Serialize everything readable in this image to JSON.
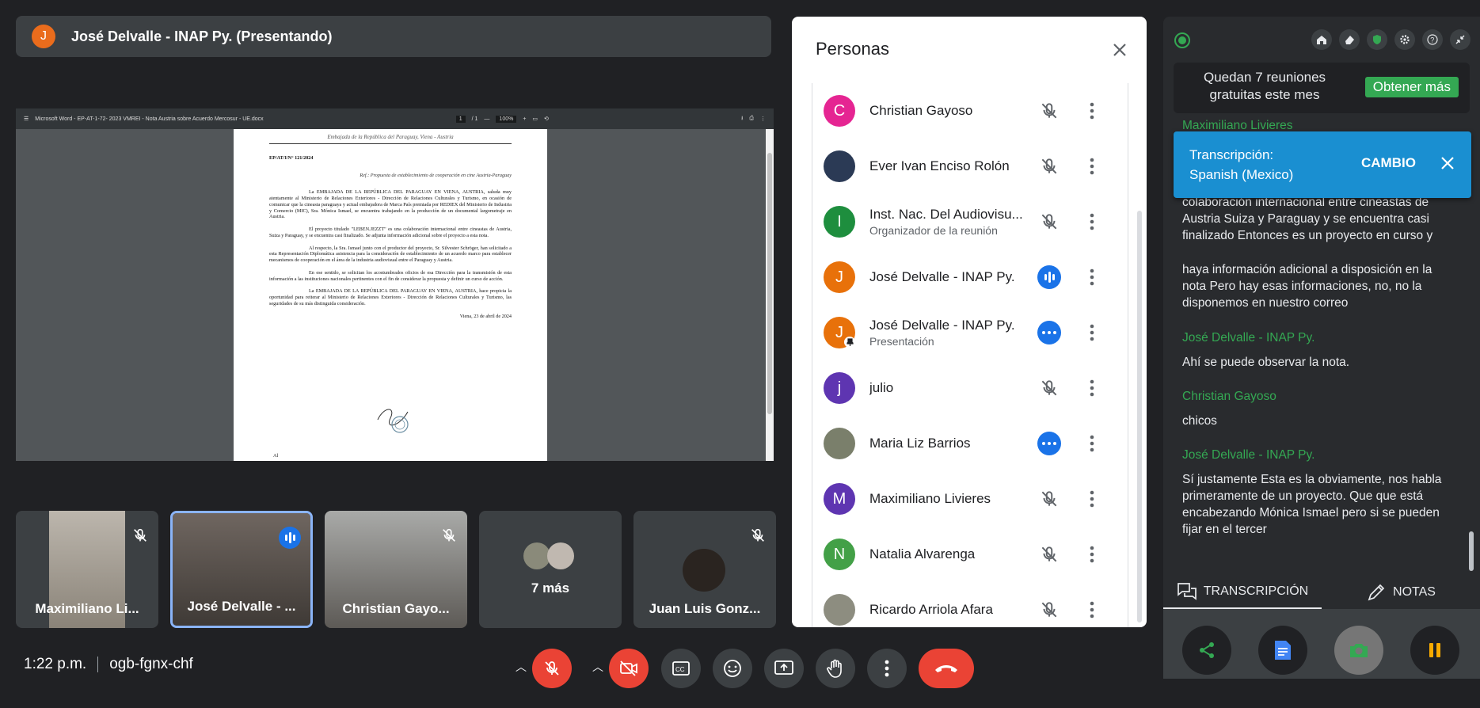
{
  "presenter": {
    "avatar_letter": "J",
    "title": "José Delvalle - INAP Py. (Presentando)"
  },
  "shared_doc": {
    "filename": "Microsoft Word - EP-AT-1-72- 2023 VMREI - Nota Austria sobre Acuerdo Mercosur - UE.docx",
    "page": "1",
    "page_total": "/ 1",
    "zoom": "100%",
    "header": "Embajada de la República del Paraguay, Viena - Austria",
    "ref_no": "EP/AT/I/N° 121/2024",
    "ref": "Ref.: Propuesta de establecimiento de cooperación en cine Austria-Paraguay",
    "paragraphs": [
      "La EMBAJADA DE LA REPÚBLICA DEL PARAGUAY EN VIENA, AUSTRIA, saluda muy atentamente al Ministerio de Relaciones Exteriores - Dirección de Relaciones Culturales y Turismo, en ocasión de comunicar que la cineasta paraguaya y actual embajadora de Marca País premiada por REDIEX del Ministerio de Industria y Comercio (MIC), Sra. Mónica Ismael, se encuentra trabajando en la producción de un documental largometraje en Austria.",
      "El proyecto titulado \"LEBEN.JEZZT\" es una colaboración internacional entre cineastas de Austria, Suiza y Paraguay, y se encuentra casi finalizado. Se adjunta información adicional sobre el proyecto a esta nota.",
      "Al respecto, la Sra. Ismael junto con el productor del proyecto, Sr. Silvester Schröger, han solicitado a esta Representación Diplomática asistencia para la consideración de establecimiento de un acuerdo marco para establecer mecanismos de cooperación en el área de la industria audiovisual entre el Paraguay y Austria.",
      "En ese sentido, se solicitan los acostumbrados oficios de esa Dirección para la transmisión de esta información a las instituciones nacionales pertinentes con el fin de considerar la propuesta y definir un curso de acción.",
      "La EMBAJADA DE LA REPÚBLICA DEL PARAGUAY EN VIENA, AUSTRIA, hace propicia la oportunidad para reiterar al Ministerio de Relaciones Exteriores - Dirección de Relaciones Culturales y Turismo, las seguridades de su más distinguida consideración."
    ],
    "date": "Viena, 23 de abril de 2024",
    "footer": "Al"
  },
  "tiles": [
    {
      "name": "Maximiliano Li...",
      "muted": true
    },
    {
      "name": "José Delvalle - ...",
      "speaking": true
    },
    {
      "name": "Christian Gayo...",
      "muted": true
    },
    {
      "name": "7 más"
    },
    {
      "name": "Juan Luis Gonz...",
      "muted": true
    }
  ],
  "meeting": {
    "time": "1:22 p.m.",
    "code": "ogb-fgnx-chf"
  },
  "people_panel": {
    "title": "Personas",
    "people": [
      {
        "initial": "C",
        "color": "#e52592",
        "name": "Christian Gayoso",
        "sub": "",
        "state": "muted"
      },
      {
        "initial": "",
        "color": "#2b3a55",
        "name": "Ever Ivan Enciso Rolón",
        "sub": "",
        "state": "muted"
      },
      {
        "initial": "I",
        "color": "#1e8e3e",
        "name": "Inst. Nac. Del Audiovisu...",
        "sub": "Organizador de la reunión",
        "state": "muted"
      },
      {
        "initial": "J",
        "color": "#e8710a",
        "name": "José Delvalle - INAP Py.",
        "sub": "",
        "state": "speaking"
      },
      {
        "initial": "J",
        "color": "#e8710a",
        "name": "José Delvalle - INAP Py.",
        "sub": "Presentación",
        "state": "idle"
      },
      {
        "initial": "j",
        "color": "#5e35b1",
        "name": "julio",
        "sub": "",
        "state": "muted"
      },
      {
        "initial": "",
        "color": "#7a7f6b",
        "name": "Maria Liz Barrios",
        "sub": "",
        "state": "idle"
      },
      {
        "initial": "M",
        "color": "#5e35b1",
        "name": "Maximiliano Livieres",
        "sub": "",
        "state": "muted"
      },
      {
        "initial": "N",
        "color": "#43a047",
        "name": "Natalia Alvarenga",
        "sub": "",
        "state": "muted"
      },
      {
        "initial": "",
        "color": "#8d8d80",
        "name": "Ricardo Arriola Afara",
        "sub": "",
        "state": "muted"
      }
    ]
  },
  "transcript": {
    "promo_text": "Quedan 7 reuniones gratuitas este mes",
    "promo_button": "Obtener más",
    "banner_line1": "Transcripción:",
    "banner_line2": "Spanish (Mexico)",
    "banner_change": "CAMBIO",
    "entries": [
      {
        "speaker": "Maximiliano Livieres",
        "text": ""
      },
      {
        "speaker": "",
        "text": "colaboración internacional entre cineastas de Austria Suiza y Paraguay y se encuentra casi finalizado Entonces es un proyecto en curso y"
      },
      {
        "speaker": "",
        "text": "haya información adicional a disposición en la nota Pero hay esas informaciones, no, no la disponemos en nuestro correo"
      },
      {
        "speaker": "José Delvalle - INAP Py.",
        "text": "Ahí se puede observar la nota."
      },
      {
        "speaker": "Christian Gayoso",
        "text": "chicos"
      },
      {
        "speaker": "José Delvalle - INAP Py.",
        "text": "Sí justamente Esta es la obviamente, nos habla primeramente de un proyecto. Que que está encabezando Mónica Ismael pero si se pueden fijar en el tercer"
      }
    ],
    "tab_transcription": "TRANSCRIPCIÓN",
    "tab_notes": "NOTAS"
  }
}
